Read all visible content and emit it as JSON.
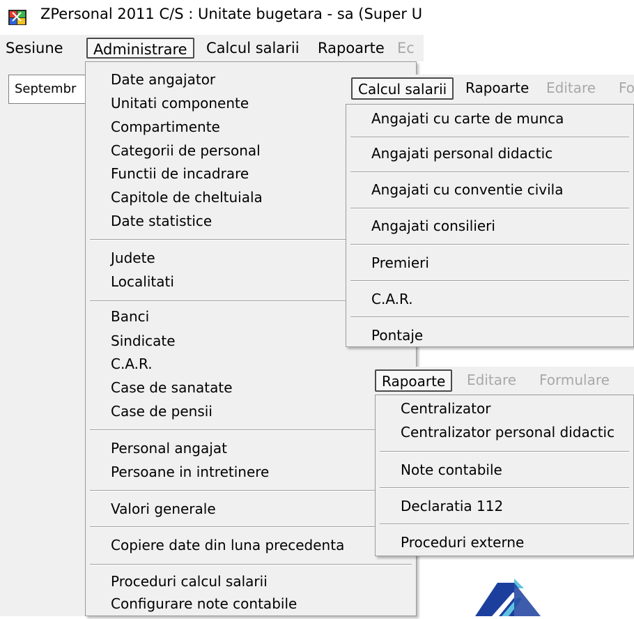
{
  "window1": {
    "title": "ZPersonal 2011 C/S : Unitate bugetara - sa (Super U",
    "app_icon": "zpersonal-app-icon",
    "menubar": [
      {
        "label": "Sesiune",
        "state": "normal"
      },
      {
        "label": "Administrare",
        "state": "active"
      },
      {
        "label": "Calcul salarii",
        "state": "normal"
      },
      {
        "label": "Rapoarte",
        "state": "normal"
      },
      {
        "label": "Ec",
        "state": "disabled"
      }
    ],
    "month_field": "Septembr"
  },
  "administrare_menu": {
    "groups": [
      [
        "Date angajator",
        "Unitati componente",
        "Compartimente",
        "Categorii de personal",
        "Functii de incadrare",
        "Capitole de cheltuiala",
        "Date statistice"
      ],
      [
        "Judete",
        "Localitati"
      ],
      [
        "Banci",
        "Sindicate",
        "C.A.R.",
        "Case de sanatate",
        "Case de pensii"
      ],
      [
        "Personal angajat",
        "Persoane in intretinere"
      ],
      [
        "Valori generale"
      ],
      [
        "Copiere date din luna precedenta"
      ],
      [
        "Proceduri calcul salarii",
        "Configurare note contabile"
      ]
    ]
  },
  "window2": {
    "menubar": [
      {
        "label": "Calcul salarii",
        "state": "active"
      },
      {
        "label": "Rapoarte",
        "state": "normal"
      },
      {
        "label": "Editare",
        "state": "disabled"
      },
      {
        "label": "Fo",
        "state": "disabled"
      }
    ],
    "menu_items": [
      "Angajati cu carte de munca",
      "Angajati personal didactic",
      "Angajati cu conventie civila",
      "Angajati consilieri",
      "Premieri",
      "C.A.R.",
      "Pontaje"
    ]
  },
  "window3": {
    "menubar": [
      {
        "label": "Rapoarte",
        "state": "active"
      },
      {
        "label": "Editare",
        "state": "disabled"
      },
      {
        "label": "Formulare",
        "state": "disabled"
      }
    ],
    "menu_groups": [
      [
        "Centralizator",
        "Centralizator personal didactic"
      ],
      [
        "Note contabile"
      ],
      [
        "Declaratia 112"
      ],
      [
        "Proceduri externe"
      ]
    ]
  },
  "logo_icon": "company-logo-icon",
  "colors": {
    "menu_bg": "#f0f0f0",
    "disabled_text": "#a8a8a8",
    "logo_blue": "#1c3f9e",
    "logo_cyan": "#5fc2e0"
  }
}
